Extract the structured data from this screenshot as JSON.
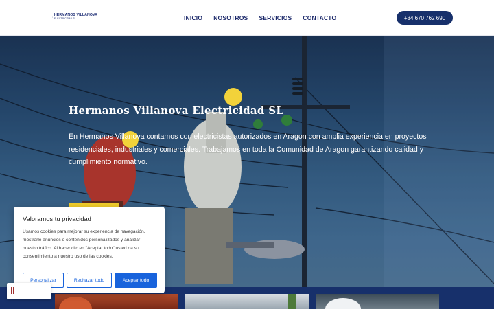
{
  "brand": {
    "logo_name": "HERMANOS VILLANOVA",
    "logo_sub": "ELECTRICIDAD SL"
  },
  "nav": {
    "items": [
      "INICIO",
      "NOSOTROS",
      "SERVICIOS",
      "CONTACTO"
    ]
  },
  "header": {
    "phone": "+34 670 762 690"
  },
  "hero": {
    "title": "Hermanos Villanova Electricidad SL",
    "text": "En Hermanos Villanova contamos con electricistas autorizados en Aragon con amplia experiencia en proyectos residenciales, industriales y comerciales. Trabajamos en toda la Comunidad de Aragon garantizando calidad y cumplimiento normativo.",
    "button_color": "#f3cf2c"
  },
  "cookie": {
    "title": "Valoramos tu privacidad",
    "text": "Usamos cookies para mejorar su experiencia de navegación, mostrarle anuncios o contenidos personalizados y analizar nuestro tráfico. Al hacer clic en \"Aceptar todo\" usted da su consentimiento a nuestro uso de las cookies.",
    "customize": "Personalizar",
    "reject": "Rechazar todo",
    "accept": "Aceptar todo"
  },
  "colors": {
    "primary": "#17306b",
    "accent_blue": "#1863dc",
    "yellow": "#f3cf2c"
  }
}
